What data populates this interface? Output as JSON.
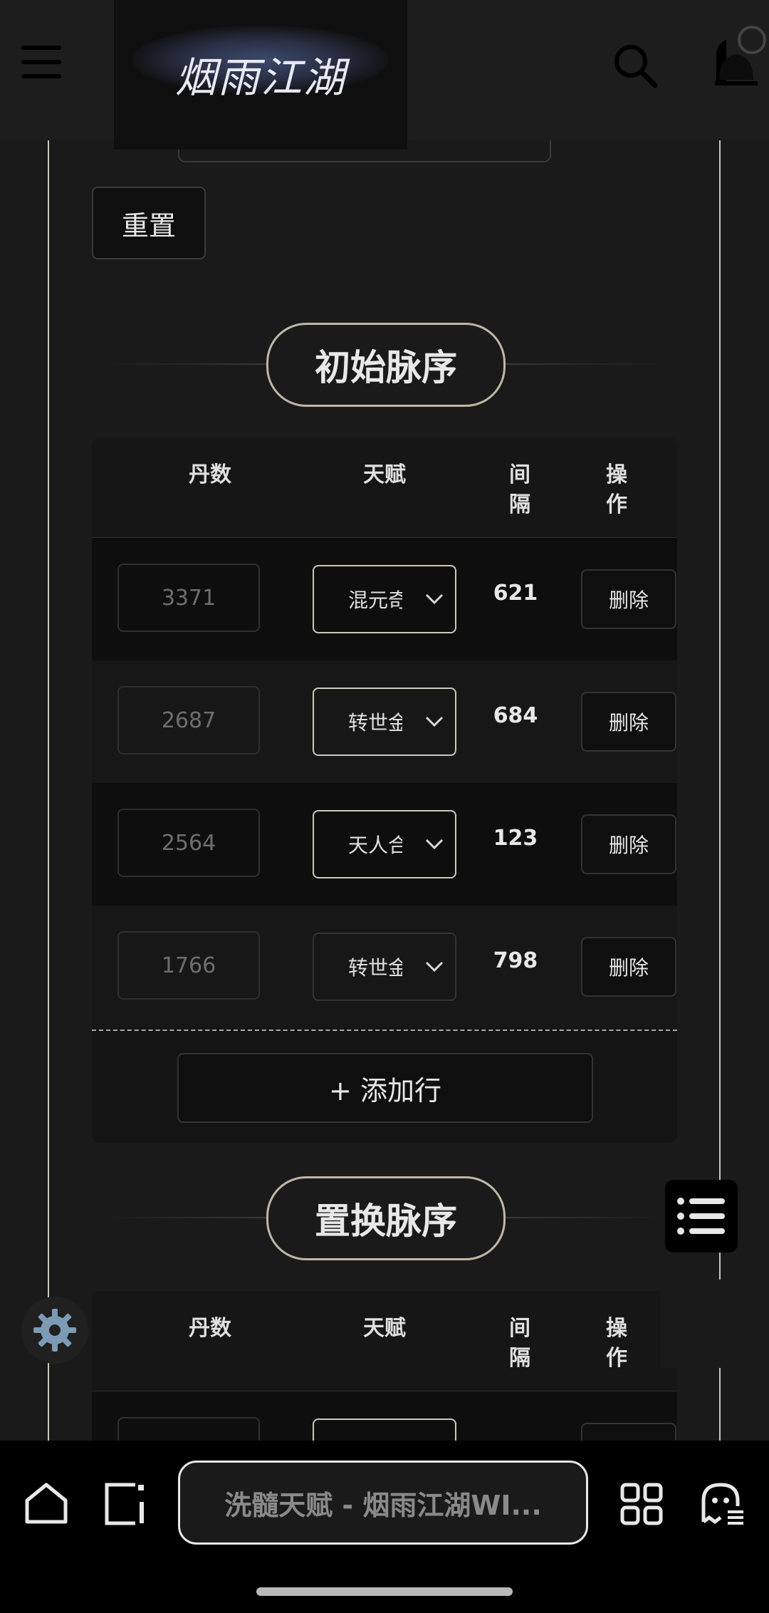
{
  "header": {
    "logo_text": "烟雨江湖"
  },
  "filters": {
    "reset_label": "重置"
  },
  "initial_section": {
    "title": "初始脉序",
    "columns": [
      "丹数",
      "天赋",
      "间\n隔",
      "操\n作"
    ],
    "rows": [
      {
        "dan": "3371",
        "talent": "混元奇",
        "gap": "621",
        "action": "删除"
      },
      {
        "dan": "2687",
        "talent": "转世金",
        "gap": "684",
        "action": "删除"
      },
      {
        "dan": "2564",
        "talent": "天人合",
        "gap": "123",
        "action": "删除"
      },
      {
        "dan": "1766",
        "talent": "转世金",
        "gap": "798",
        "action": "删除"
      }
    ],
    "add_row_label": "+ 添加行"
  },
  "replace_section": {
    "title": "置换脉序",
    "columns": [
      "丹数",
      "天赋",
      "间\n隔",
      "操\n作"
    ]
  },
  "browser": {
    "url_title": "洗髓天赋 - 烟雨江湖WI..."
  },
  "colors": {
    "background": "#1a1a1a",
    "accent_border": "#cfc7b8",
    "text": "#e8e8e8"
  }
}
